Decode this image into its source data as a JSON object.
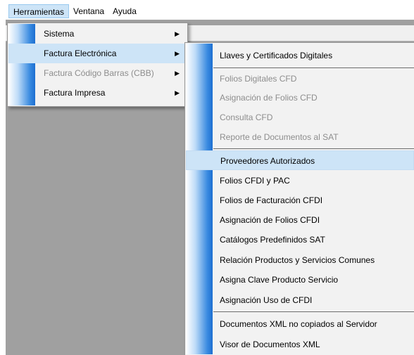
{
  "menubar": {
    "items": [
      "Herramientas",
      "Ventana",
      "Ayuda"
    ]
  },
  "menu1": {
    "items": [
      {
        "label": "Sistema",
        "submenu": true,
        "enabled": true,
        "highlighted": false
      },
      {
        "label": "Factura Electrónica",
        "submenu": true,
        "enabled": true,
        "highlighted": true
      },
      {
        "label": "Factura Código Barras (CBB)",
        "submenu": true,
        "enabled": false,
        "highlighted": false
      },
      {
        "label": "Factura Impresa",
        "submenu": true,
        "enabled": true,
        "highlighted": false
      }
    ]
  },
  "menu2": {
    "items": [
      {
        "label": "Llaves y Certificados Digitales",
        "enabled": true
      },
      {
        "label": "Folios Digitales CFD",
        "enabled": false
      },
      {
        "label": "Asignación de Folios CFD",
        "enabled": false
      },
      {
        "label": "Consulta CFD",
        "enabled": false
      },
      {
        "label": "Reporte de Documentos al SAT",
        "enabled": false
      },
      {
        "label": "Proveedores Autorizados",
        "enabled": true,
        "highlighted": true
      },
      {
        "label": "Folios CFDI y PAC",
        "enabled": true
      },
      {
        "label": "Folios de Facturación CFDI",
        "enabled": true
      },
      {
        "label": "Asignación de Folios CFDI",
        "enabled": true
      },
      {
        "label": "Catálogos Predefinidos SAT",
        "enabled": true
      },
      {
        "label": "Relación Productos y Servicios Comunes",
        "enabled": true
      },
      {
        "label": "Asigna Clave Producto Servicio",
        "enabled": true
      },
      {
        "label": "Asignación Uso de CFDI",
        "enabled": true
      },
      {
        "label": "Documentos XML no copiados al Servidor",
        "enabled": true
      },
      {
        "label": "Visor de Documentos XML",
        "enabled": true
      }
    ]
  },
  "colors": {
    "highlight": "#cde4f7",
    "disabled_text": "#8d8d8d",
    "app_background": "#a0a0a0",
    "gutter_blue": "#1d6fd1"
  }
}
